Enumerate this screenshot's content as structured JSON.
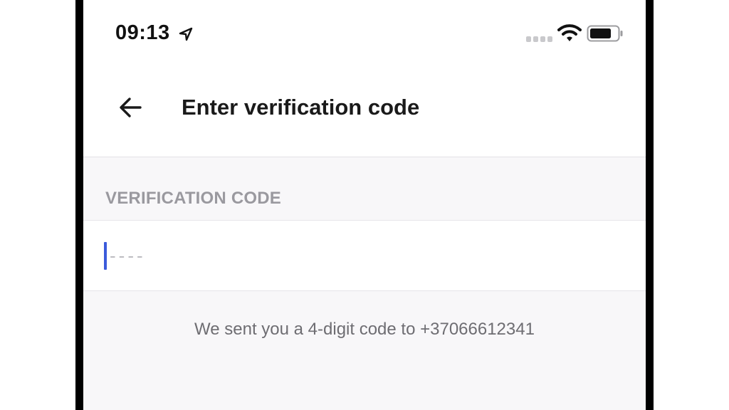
{
  "status_bar": {
    "time": "09:13",
    "icons": [
      "location-arrow-icon",
      "cellular-signal-icon",
      "wifi-icon",
      "battery-icon"
    ]
  },
  "header": {
    "back_icon": "arrow-left-icon",
    "title": "Enter verification code"
  },
  "form": {
    "section_label": "VERIFICATION CODE",
    "code_value": "",
    "code_placeholder": "----"
  },
  "helper": {
    "text": "We sent you a 4-digit code to +37066612341"
  },
  "colors": {
    "accent_cursor": "#3b5bdb",
    "background": "#f8f7f9",
    "label": "#9a999f"
  }
}
